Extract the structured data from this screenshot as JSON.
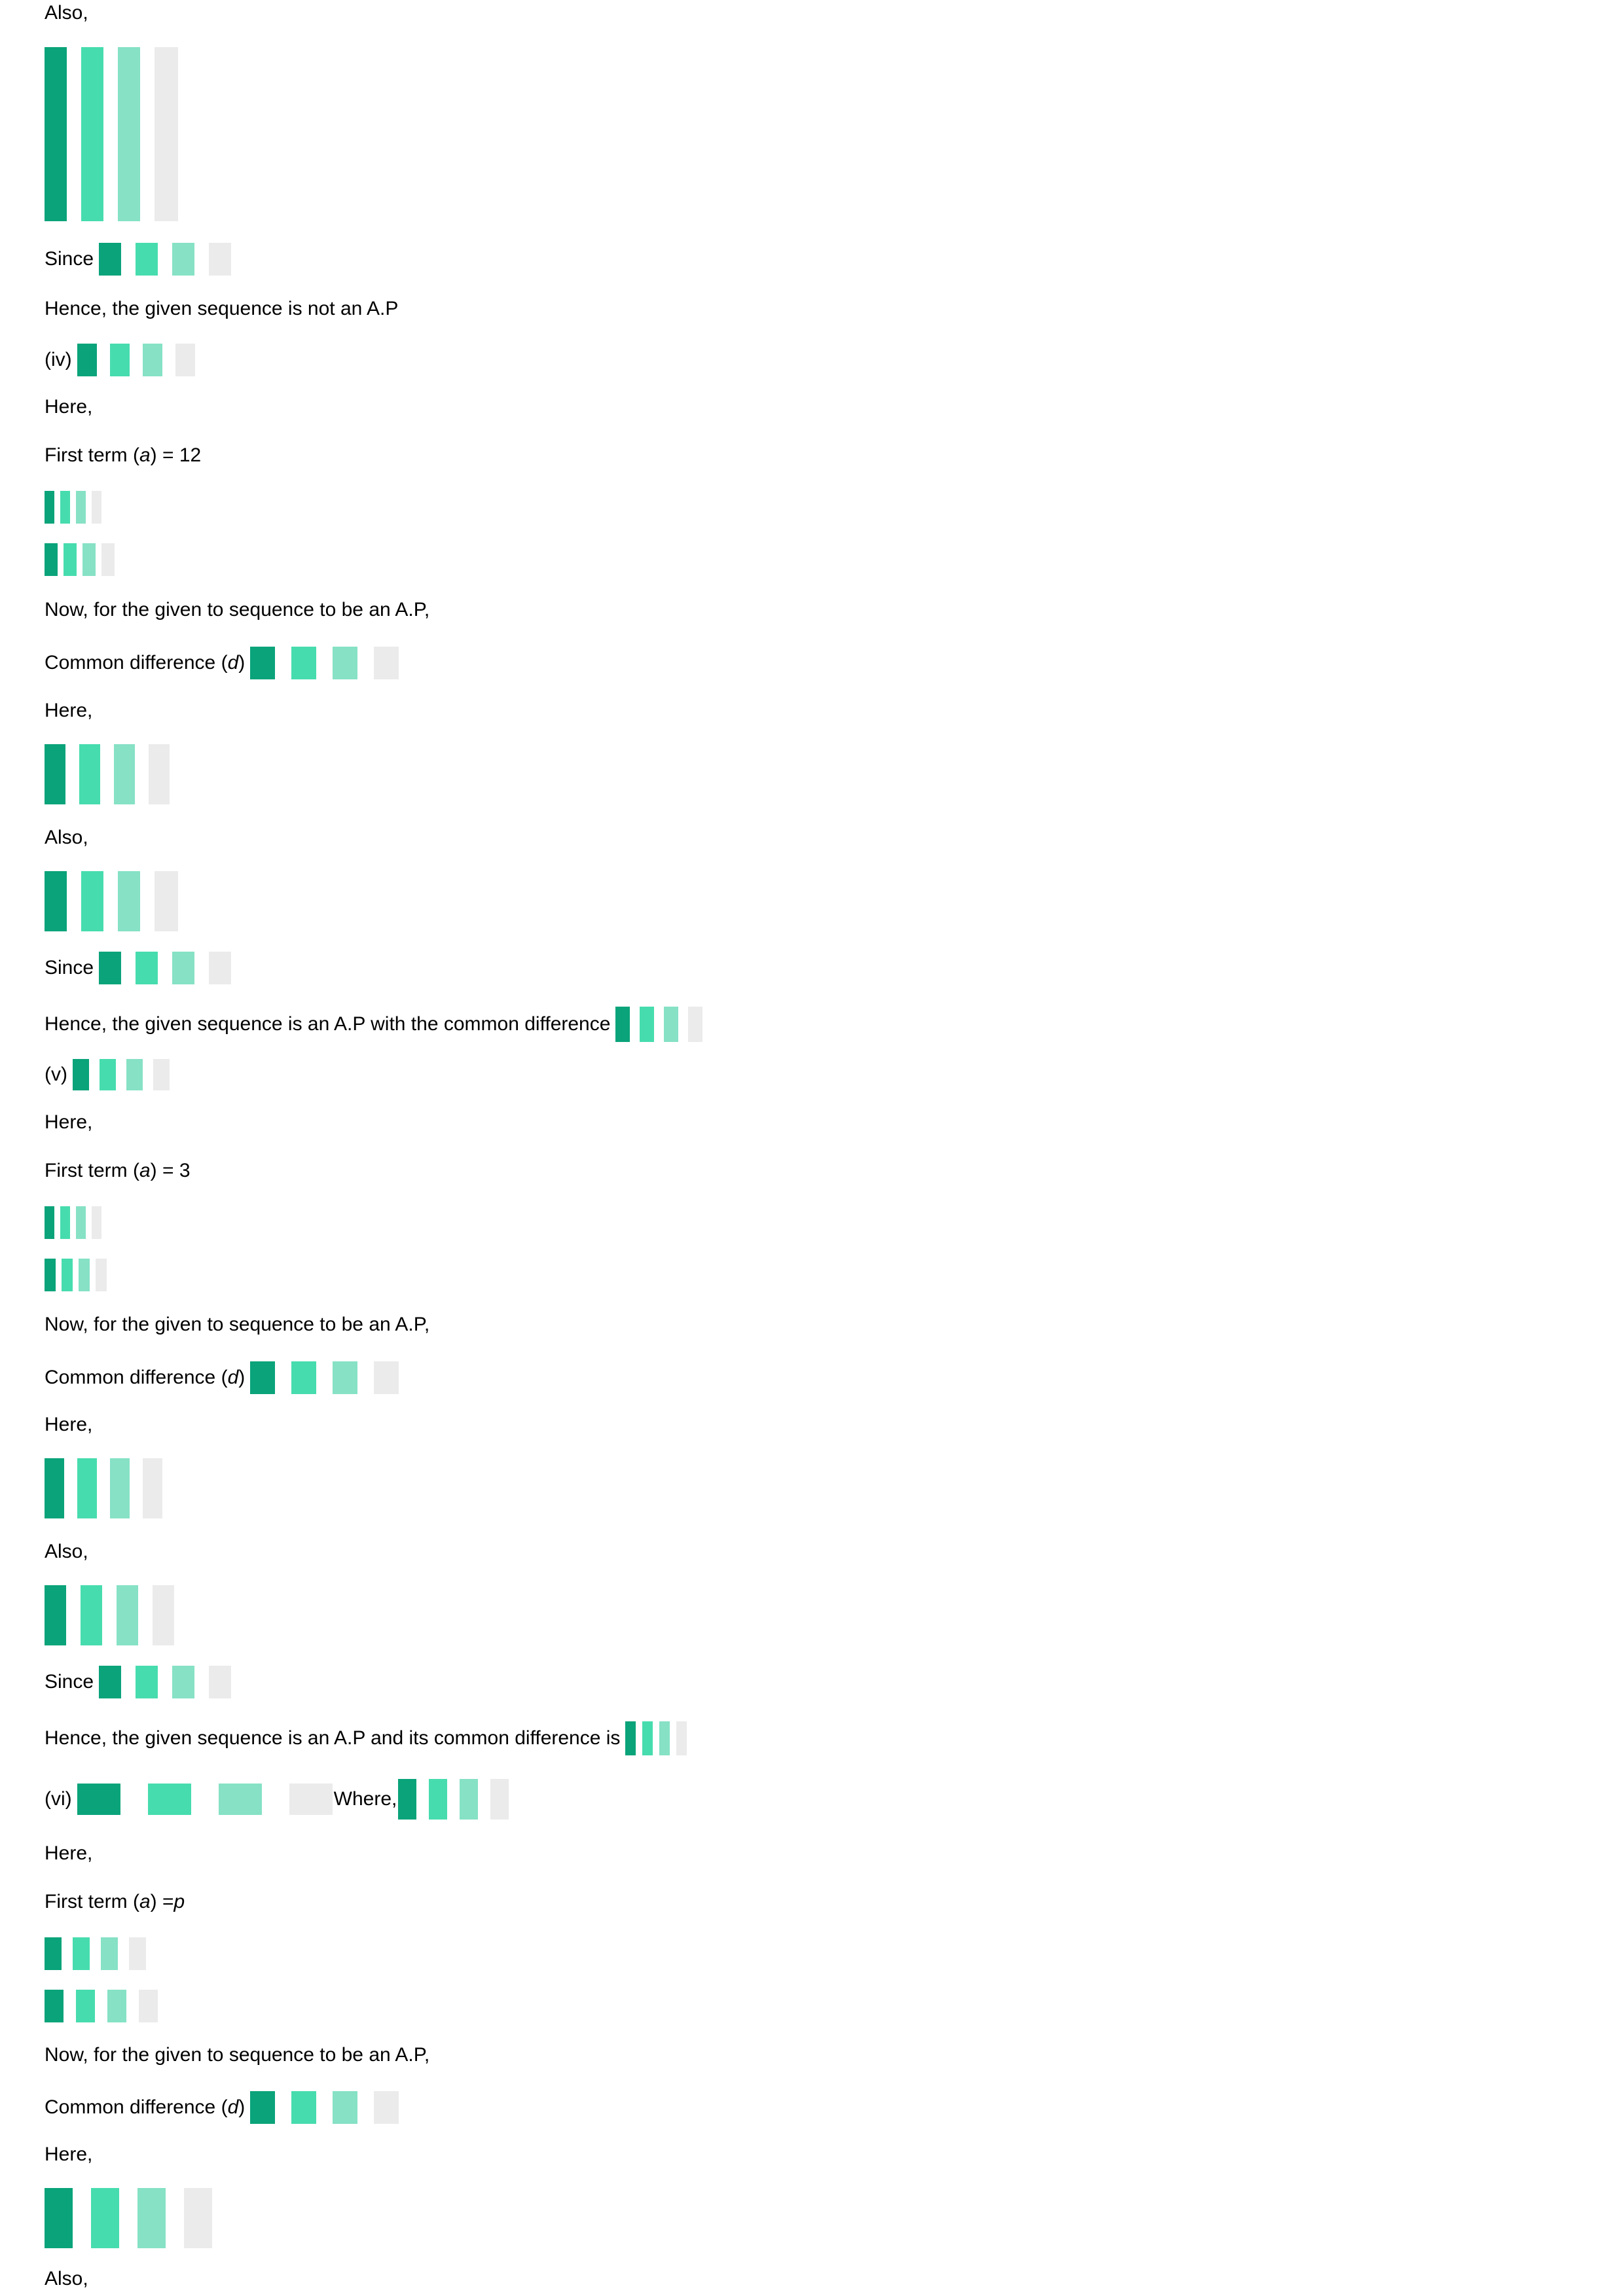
{
  "lines": {
    "also_1": "Also,",
    "since_1": "Since",
    "not_ap": "Hence, the given sequence is not an A.P",
    "iv_label": "(iv)",
    "here_1": "Here,",
    "first_term_1_prefix": "First term (",
    "first_term_1_var": "a",
    "first_term_1_suffix": ") = 12",
    "now_1": "Now, for the given to sequence to be an A.P,",
    "cd_1_prefix": "Common difference (",
    "cd_1_var": "d",
    "cd_1_suffix": ")",
    "here_2": "Here,",
    "also_2": "Also,",
    "since_2": "Since",
    "is_ap_cd": "Hence, the given sequence is an A.P with the common difference",
    "v_label": "(v)",
    "here_3": "Here,",
    "first_term_2_prefix": "First term (",
    "first_term_2_var": "a",
    "first_term_2_suffix": ") = 3",
    "now_2": "Now, for the given to sequence to be an A.P,",
    "cd_2_prefix": "Common difference (",
    "cd_2_var": "d",
    "cd_2_suffix": ")",
    "here_4": "Here,",
    "also_3": "Also,",
    "since_3": "Since",
    "is_ap_its_cd": "Hence, the given sequence is an A.P and its common difference is",
    "vi_label": "(vi)",
    "where": "Where,",
    "here_5": "Here,",
    "first_term_3_prefix": "First term (",
    "first_term_3_var": "a",
    "first_term_3_suffix": ") = ",
    "first_term_3_value": "p",
    "now_3": "Now, for the given to sequence to be an A.P,",
    "cd_3_prefix": "Common difference (",
    "cd_3_var": "d",
    "cd_3_suffix": ")",
    "here_6": "Here,",
    "also_4": "Also,"
  },
  "colors": {
    "equation_placeholder_1": "#0aa37a",
    "equation_placeholder_2": "#47dcae",
    "equation_placeholder_3": "#86e1c5",
    "equation_placeholder_4": "#ebebeb"
  }
}
